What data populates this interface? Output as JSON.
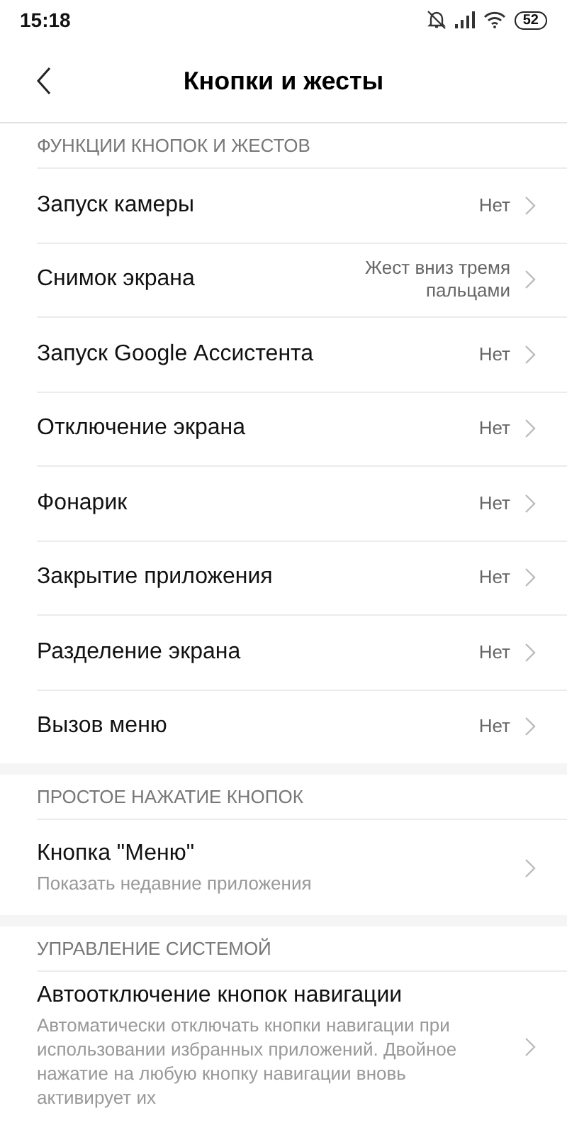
{
  "status_bar": {
    "time": "15:18",
    "battery": "52"
  },
  "header": {
    "title": "Кнопки и жесты"
  },
  "sections": [
    {
      "title": "ФУНКЦИИ КНОПОК И ЖЕСТОВ",
      "items": [
        {
          "label": "Запуск камеры",
          "value": "Нет"
        },
        {
          "label": "Снимок экрана",
          "value": "Жест вниз тремя пальцами"
        },
        {
          "label": "Запуск Google Ассистента",
          "value": "Нет"
        },
        {
          "label": "Отключение экрана",
          "value": "Нет"
        },
        {
          "label": "Фонарик",
          "value": "Нет"
        },
        {
          "label": "Закрытие приложения",
          "value": "Нет"
        },
        {
          "label": "Разделение экрана",
          "value": "Нет"
        },
        {
          "label": "Вызов меню",
          "value": "Нет"
        }
      ]
    },
    {
      "title": "ПРОСТОЕ НАЖАТИЕ КНОПОК",
      "items": [
        {
          "label": "Кнопка \"Меню\"",
          "subtitle": "Показать недавние приложения"
        }
      ]
    },
    {
      "title": "УПРАВЛЕНИЕ СИСТЕМОЙ",
      "items": [
        {
          "label": "Автоотключение кнопок навигации",
          "subtitle": "Автоматически отключать кнопки навигации при использовании избранных приложений. Двойное нажатие на любую кнопку навигации вновь активирует их"
        }
      ]
    }
  ]
}
